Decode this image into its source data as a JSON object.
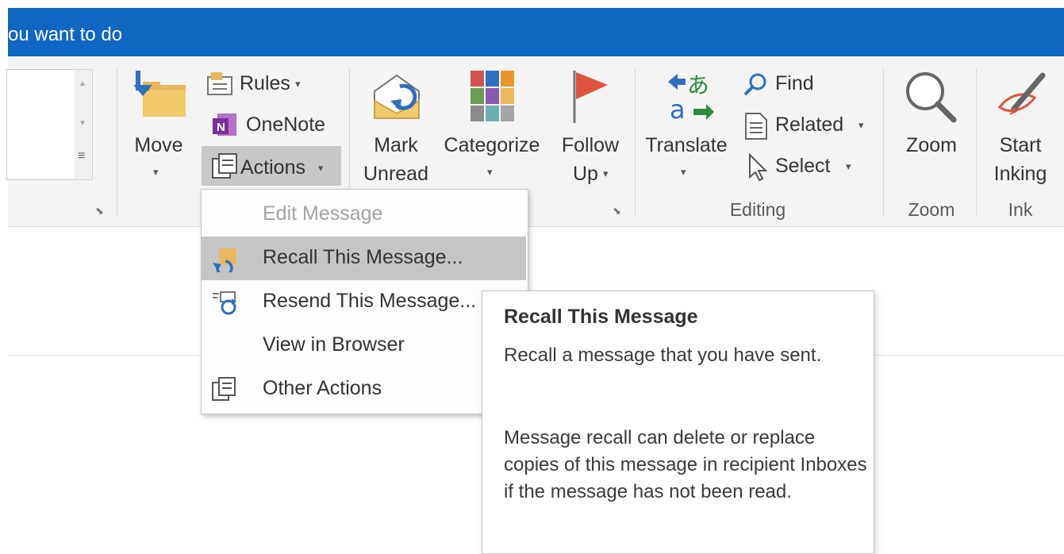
{
  "titlebar": {
    "tell_me": "ou want to do",
    "color": "#0f67c2"
  },
  "ribbon": {
    "move": {
      "label": "Move",
      "caret": "▾"
    },
    "rules": {
      "label": "Rules",
      "caret": "▾"
    },
    "onenote": {
      "label": "OneNote"
    },
    "actions": {
      "label": "Actions",
      "caret": "▾"
    },
    "mark_unread": {
      "line1": "Mark",
      "line2": "Unread"
    },
    "categorize": {
      "label": "Categorize",
      "caret": "▾"
    },
    "follow_up": {
      "line1": "Follow",
      "line2": "Up",
      "caret": "▾"
    },
    "translate": {
      "label": "Translate",
      "caret": "▾"
    },
    "find": {
      "label": "Find"
    },
    "related": {
      "label": "Related",
      "caret": "▾"
    },
    "select": {
      "label": "Select",
      "caret": "▾"
    },
    "zoom": {
      "label": "Zoom"
    },
    "start_inking": {
      "line1": "Start",
      "line2": "Inking"
    },
    "groups": {
      "editing": "Editing",
      "zoom": "Zoom",
      "ink": "Ink"
    }
  },
  "actions_menu": {
    "items": [
      {
        "label": "Edit Message",
        "state": "disabled",
        "icon": "none"
      },
      {
        "label": "Recall This Message...",
        "state": "highlighted",
        "icon": "recall-icon"
      },
      {
        "label": "Resend This Message...",
        "state": "normal",
        "icon": "resend-icon"
      },
      {
        "label": "View in Browser",
        "state": "normal",
        "icon": "none"
      },
      {
        "label": "Other Actions",
        "state": "normal",
        "icon": "other-actions-icon"
      }
    ]
  },
  "tooltip": {
    "title": "Recall This Message",
    "body1": "Recall a message that you have sent.",
    "body2": "Message recall can delete or replace copies of this message in recipient Inboxes if the message has not been read."
  },
  "colors": {
    "accent": "#0f67c2",
    "menu_highlight": "#c5c5c5",
    "ribbon_bg": "#f4f4f4"
  }
}
